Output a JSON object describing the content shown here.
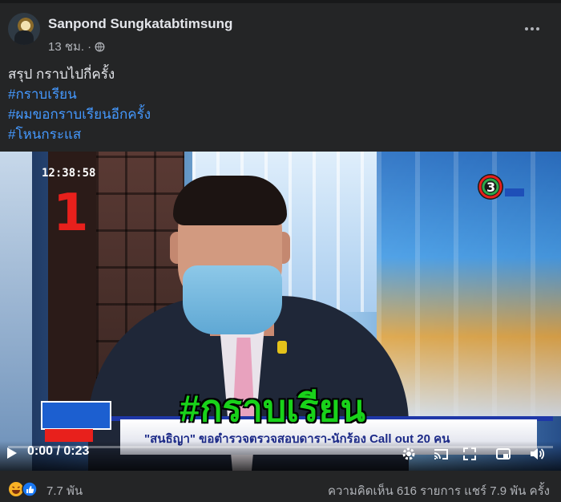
{
  "post": {
    "author": "Sanpond Sungkatabtimsung",
    "time": "13 ชม.",
    "separator": "·",
    "text": "สรุป กราบไปกี่ครั้ง",
    "hashtags": [
      "#กราบเรียน",
      "#ผมขอกราบเรียนอีกครั้ง",
      "#โหนกระแส"
    ]
  },
  "video": {
    "timestamp": "12:38:58",
    "big_number": "1",
    "overlay_hashtag": "#กราบเรียน",
    "lower_third": "\"สนธิญา\" ขอตำรวจตรวจสอบดารา-นักร้อง Call out 20 คน",
    "current_time": "0:00",
    "time_separator": "/",
    "duration": "0:23",
    "progress_fraction": 0
  },
  "footer": {
    "reaction_count": "7.7 พัน",
    "stats": "ความคิดเห็น 616 รายการ  แชร์ 7.9 พัน ครั้ง"
  },
  "colors": {
    "background": "#242526",
    "hashtag": "#4599ff",
    "overlay_green": "#19d21a"
  },
  "icons": [
    "globe-icon",
    "more-icon",
    "play-icon",
    "settings-icon",
    "cast-icon",
    "fullscreen-icon",
    "pip-icon",
    "volume-icon",
    "haha-reaction-icon",
    "like-reaction-icon"
  ]
}
